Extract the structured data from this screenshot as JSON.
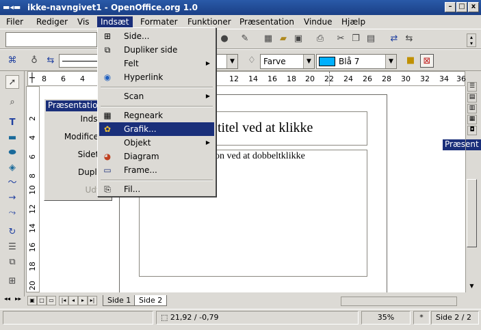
{
  "window": {
    "title": "ikke-navngivet1 - OpenOffice.org 1.0",
    "controls": [
      "–",
      "□",
      "x"
    ]
  },
  "menubar": [
    "Filer",
    "Rediger",
    "Vis",
    "Indsæt",
    "Formater",
    "Funktioner",
    "Præsentation",
    "Vindue",
    "Hjælp"
  ],
  "toolbar2": {
    "color_mode": "Farve",
    "fill_color": "Blå 7",
    "fill_color_hex": "#00b0ff"
  },
  "hruler_ticks": [
    "8",
    "6",
    "4",
    "12",
    "14",
    "16",
    "18",
    "20",
    "22",
    "24",
    "26",
    "28",
    "30",
    "32",
    "34",
    "36"
  ],
  "vruler_ticks": [
    "2",
    "4",
    "6",
    "8",
    "10",
    "12",
    "14",
    "16",
    "18",
    "20"
  ],
  "slide": {
    "title_text": "titel ved at klikke",
    "body_text": "on ved at dobbeltklikke"
  },
  "navigator": {
    "title": "Præsentatio",
    "items": [
      "Indsæt",
      "Modificer s",
      "Sidetyp",
      "Duplike",
      "Udvid"
    ]
  },
  "right_panel": {
    "label": "Præsent"
  },
  "insert_menu": {
    "items": [
      {
        "label": "Side...",
        "icon": "new-slide-icon"
      },
      {
        "label": "Dupliker side",
        "icon": "duplicate-slide-icon"
      },
      {
        "label": "Felt",
        "icon": "",
        "submenu": true
      },
      {
        "label": "Hyperlink",
        "icon": "hyperlink-icon"
      },
      {
        "label": "Scan",
        "icon": "",
        "submenu": true
      },
      {
        "label": "Regneark",
        "icon": "spreadsheet-icon"
      },
      {
        "label": "Grafik...",
        "icon": "graphic-icon",
        "highlighted": true
      },
      {
        "label": "Objekt",
        "icon": "",
        "submenu": true
      },
      {
        "label": "Diagram",
        "icon": "chart-icon"
      },
      {
        "label": "Frame...",
        "icon": "frame-icon"
      },
      {
        "label": "Fil...",
        "icon": "file-icon"
      }
    ]
  },
  "tabs": [
    "Side 1",
    "Side 2"
  ],
  "active_tab": "Side 2",
  "status": {
    "position": "21,92 / -0,79",
    "zoom": "35%",
    "modified": "*",
    "page": "Side 2 / 2"
  }
}
